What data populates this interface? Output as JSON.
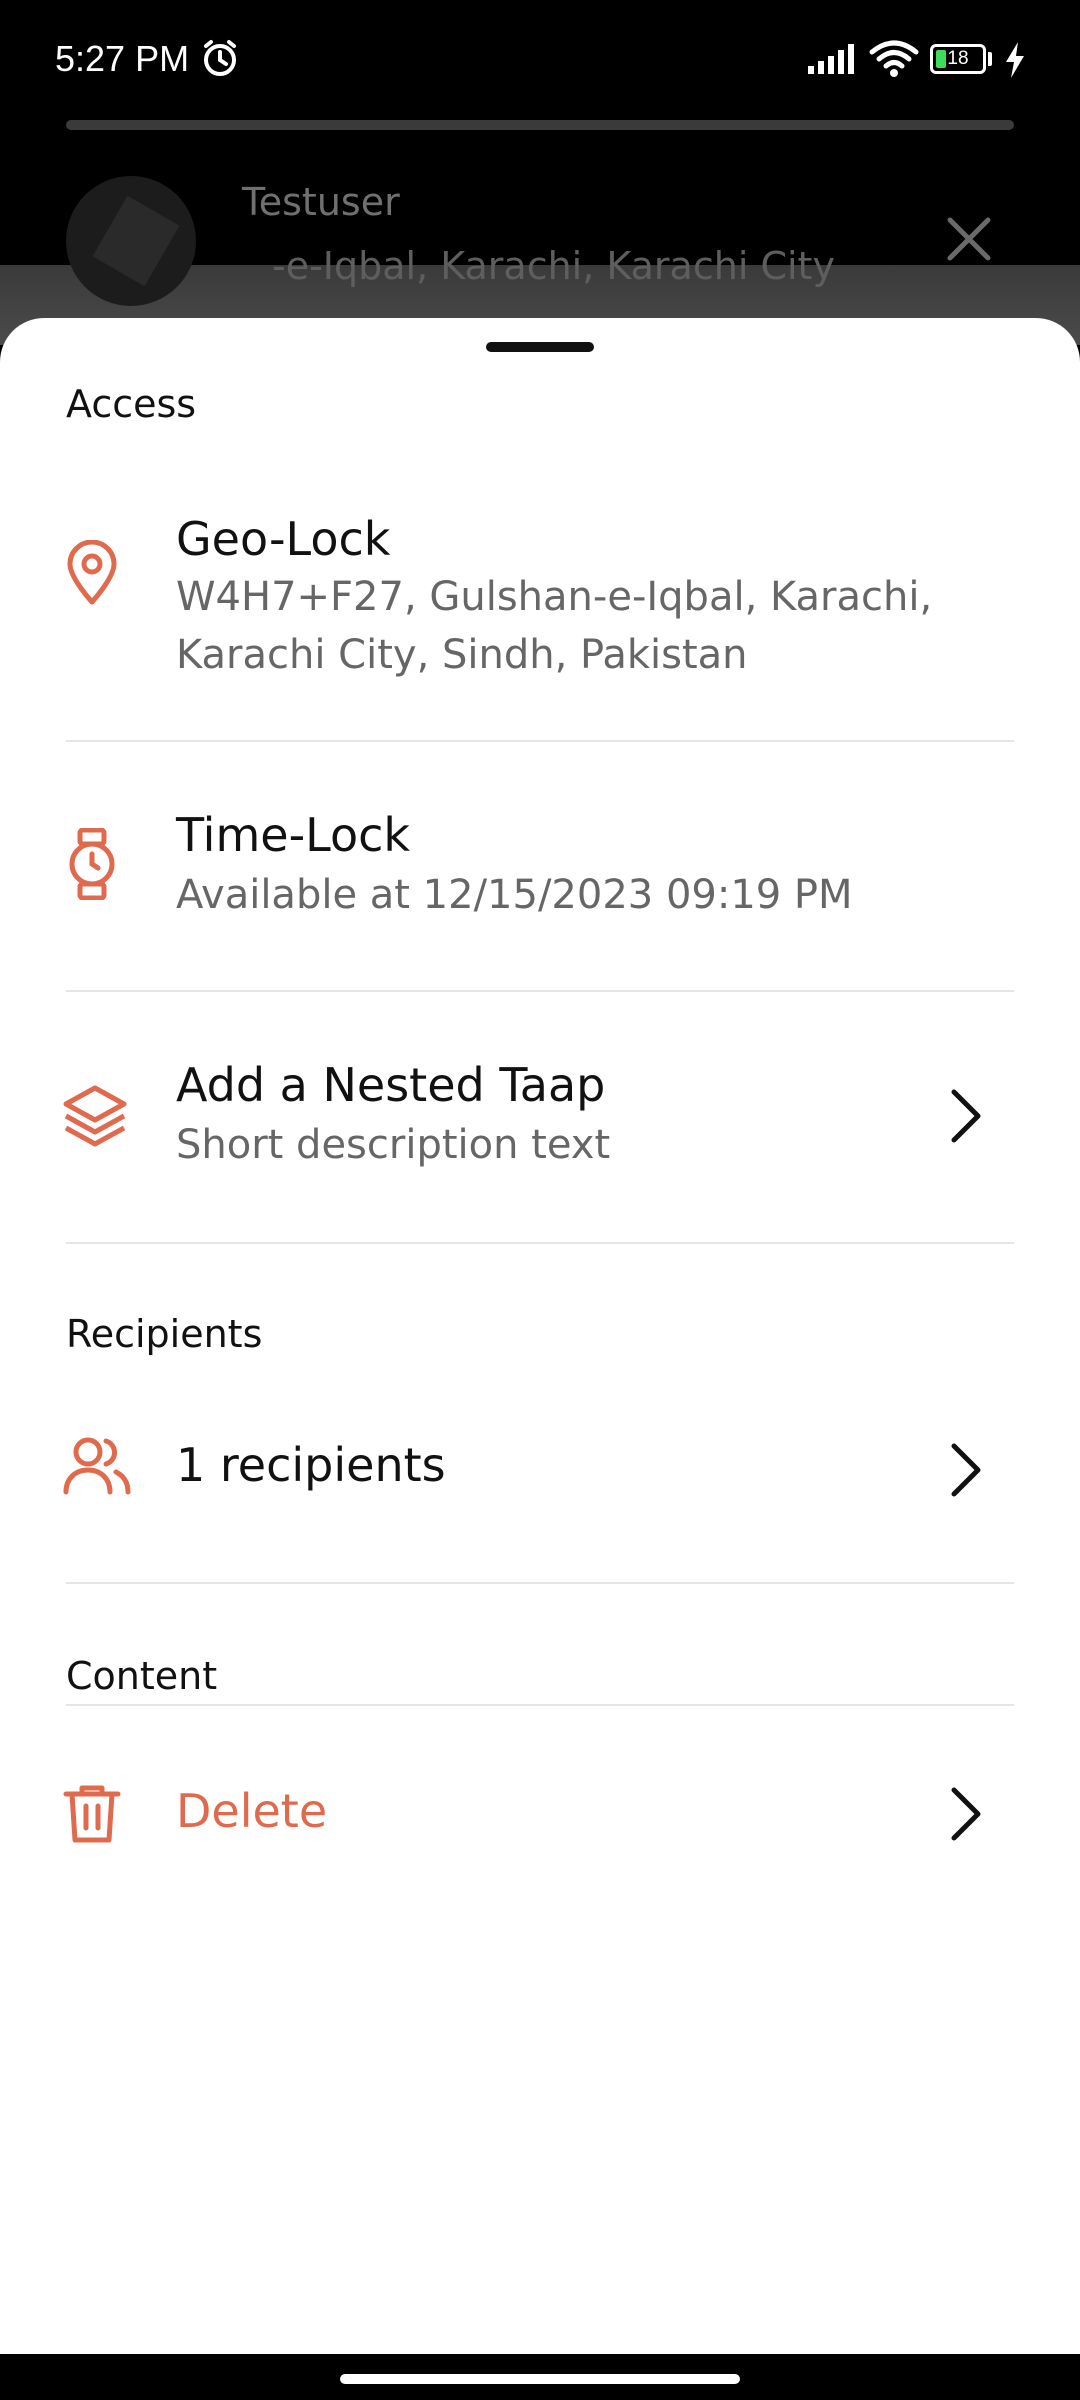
{
  "status_bar": {
    "time": "5:27 PM",
    "battery": "18",
    "icons": [
      "alarm-icon",
      "signal-icon",
      "wifi-icon",
      "battery-icon",
      "charging-icon"
    ]
  },
  "background": {
    "user_name": "Testuser",
    "location": "-e-Iqbal, Karachi, Karachi City"
  },
  "sheet": {
    "access_title": "Access",
    "geo_lock": {
      "title": "Geo-Lock",
      "address_line1": "W4H7+F27, Gulshan-e-Iqbal, Karachi,",
      "address_line2": "Karachi City, Sindh, Pakistan",
      "icon": "location-pin-icon"
    },
    "time_lock": {
      "title": "Time-Lock",
      "subtitle": "Available at 12/15/2023 09:19 PM",
      "icon": "watch-icon"
    },
    "nested": {
      "title": "Add a Nested Taap",
      "subtitle": "Short description text",
      "icon": "layers-icon"
    },
    "recipients_title": "Recipients",
    "recipients": {
      "label": "1 recipients",
      "icon": "users-icon"
    },
    "content_title": "Content",
    "delete": {
      "label": "Delete",
      "icon": "trash-icon"
    }
  },
  "colors": {
    "accent": "#E06A4E",
    "text": "#111111",
    "muted": "#666666",
    "divider": "#E6E6E6"
  }
}
